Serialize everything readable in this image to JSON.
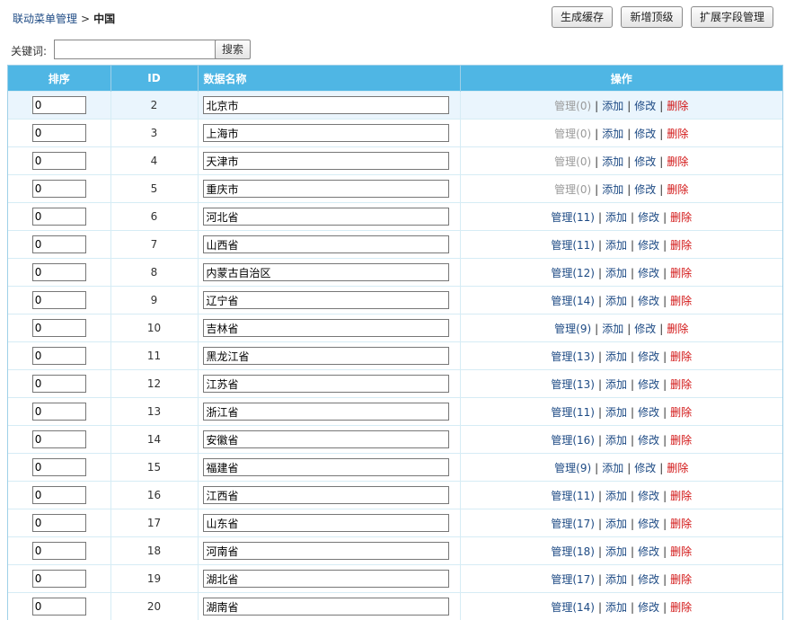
{
  "breadcrumb": {
    "parent": "联动菜单管理",
    "separator": ">",
    "current": "中国"
  },
  "toolbar": {
    "generate_cache": "生成缓存",
    "add_top": "新增顶级",
    "extend_fields": "扩展字段管理"
  },
  "search": {
    "label": "关键词:",
    "value": "",
    "button": "搜索"
  },
  "table": {
    "headers": {
      "order": "排序",
      "id": "ID",
      "name": "数据名称",
      "actions": "操作"
    },
    "action_labels": {
      "add": "添加",
      "edit": "修改",
      "delete": "删除",
      "separator": "|"
    },
    "rows": [
      {
        "order": "0",
        "id": "2",
        "name": "北京市",
        "manage": "管理(0)",
        "manage_disabled": true
      },
      {
        "order": "0",
        "id": "3",
        "name": "上海市",
        "manage": "管理(0)",
        "manage_disabled": true
      },
      {
        "order": "0",
        "id": "4",
        "name": "天津市",
        "manage": "管理(0)",
        "manage_disabled": true
      },
      {
        "order": "0",
        "id": "5",
        "name": "重庆市",
        "manage": "管理(0)",
        "manage_disabled": true
      },
      {
        "order": "0",
        "id": "6",
        "name": "河北省",
        "manage": "管理(11)",
        "manage_disabled": false
      },
      {
        "order": "0",
        "id": "7",
        "name": "山西省",
        "manage": "管理(11)",
        "manage_disabled": false
      },
      {
        "order": "0",
        "id": "8",
        "name": "内蒙古自治区",
        "manage": "管理(12)",
        "manage_disabled": false
      },
      {
        "order": "0",
        "id": "9",
        "name": "辽宁省",
        "manage": "管理(14)",
        "manage_disabled": false
      },
      {
        "order": "0",
        "id": "10",
        "name": "吉林省",
        "manage": "管理(9)",
        "manage_disabled": false
      },
      {
        "order": "0",
        "id": "11",
        "name": "黑龙江省",
        "manage": "管理(13)",
        "manage_disabled": false
      },
      {
        "order": "0",
        "id": "12",
        "name": "江苏省",
        "manage": "管理(13)",
        "manage_disabled": false
      },
      {
        "order": "0",
        "id": "13",
        "name": "浙江省",
        "manage": "管理(11)",
        "manage_disabled": false
      },
      {
        "order": "0",
        "id": "14",
        "name": "安徽省",
        "manage": "管理(16)",
        "manage_disabled": false
      },
      {
        "order": "0",
        "id": "15",
        "name": "福建省",
        "manage": "管理(9)",
        "manage_disabled": false
      },
      {
        "order": "0",
        "id": "16",
        "name": "江西省",
        "manage": "管理(11)",
        "manage_disabled": false
      },
      {
        "order": "0",
        "id": "17",
        "name": "山东省",
        "manage": "管理(17)",
        "manage_disabled": false
      },
      {
        "order": "0",
        "id": "18",
        "name": "河南省",
        "manage": "管理(18)",
        "manage_disabled": false
      },
      {
        "order": "0",
        "id": "19",
        "name": "湖北省",
        "manage": "管理(17)",
        "manage_disabled": false
      },
      {
        "order": "0",
        "id": "20",
        "name": "湖南省",
        "manage": "管理(14)",
        "manage_disabled": false
      }
    ]
  },
  "colors": {
    "header_bg": "#4fb6e4",
    "link": "#1d4a84",
    "delete": "#d21414",
    "disabled": "#999999",
    "highlight_row": "#eaf5fd"
  }
}
